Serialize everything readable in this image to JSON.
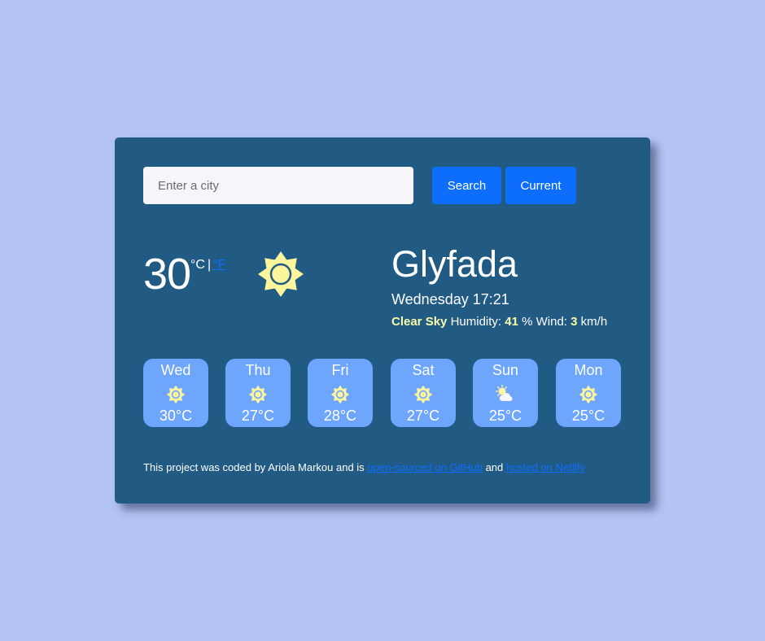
{
  "search": {
    "placeholder": "Enter a city",
    "search_label": "Search",
    "current_label": "Current"
  },
  "current": {
    "temperature": "30",
    "unit_c": "°C",
    "separator": "|",
    "unit_f": "°F",
    "icon": "sun-icon"
  },
  "location": {
    "city": "Glyfada",
    "datetime": "Wednesday 17:21",
    "description": "Clear Sky",
    "humidity_label": "Humidity:",
    "humidity_value": "41",
    "humidity_unit": "%",
    "wind_label": "Wind:",
    "wind_value": "3",
    "wind_unit": "km/h"
  },
  "forecast": [
    {
      "day": "Wed",
      "temp": "30°C",
      "icon": "sun-icon"
    },
    {
      "day": "Thu",
      "temp": "27°C",
      "icon": "sun-icon"
    },
    {
      "day": "Fri",
      "temp": "28°C",
      "icon": "sun-icon"
    },
    {
      "day": "Sat",
      "temp": "27°C",
      "icon": "sun-icon"
    },
    {
      "day": "Sun",
      "temp": "25°C",
      "icon": "sun-cloud-icon"
    },
    {
      "day": "Mon",
      "temp": "25°C",
      "icon": "sun-icon"
    }
  ],
  "footer": {
    "text_before": "This project was coded by Ariola Markou and is ",
    "link1": "open-sourced on GitHub",
    "text_middle": " and ",
    "link2": "hosted on Netlify"
  },
  "colors": {
    "background": "#b2c3f4",
    "card": "#215a83",
    "button": "#0d6efd",
    "forecast_tile": "#6ea6fd",
    "highlight": "#fbfbad"
  }
}
